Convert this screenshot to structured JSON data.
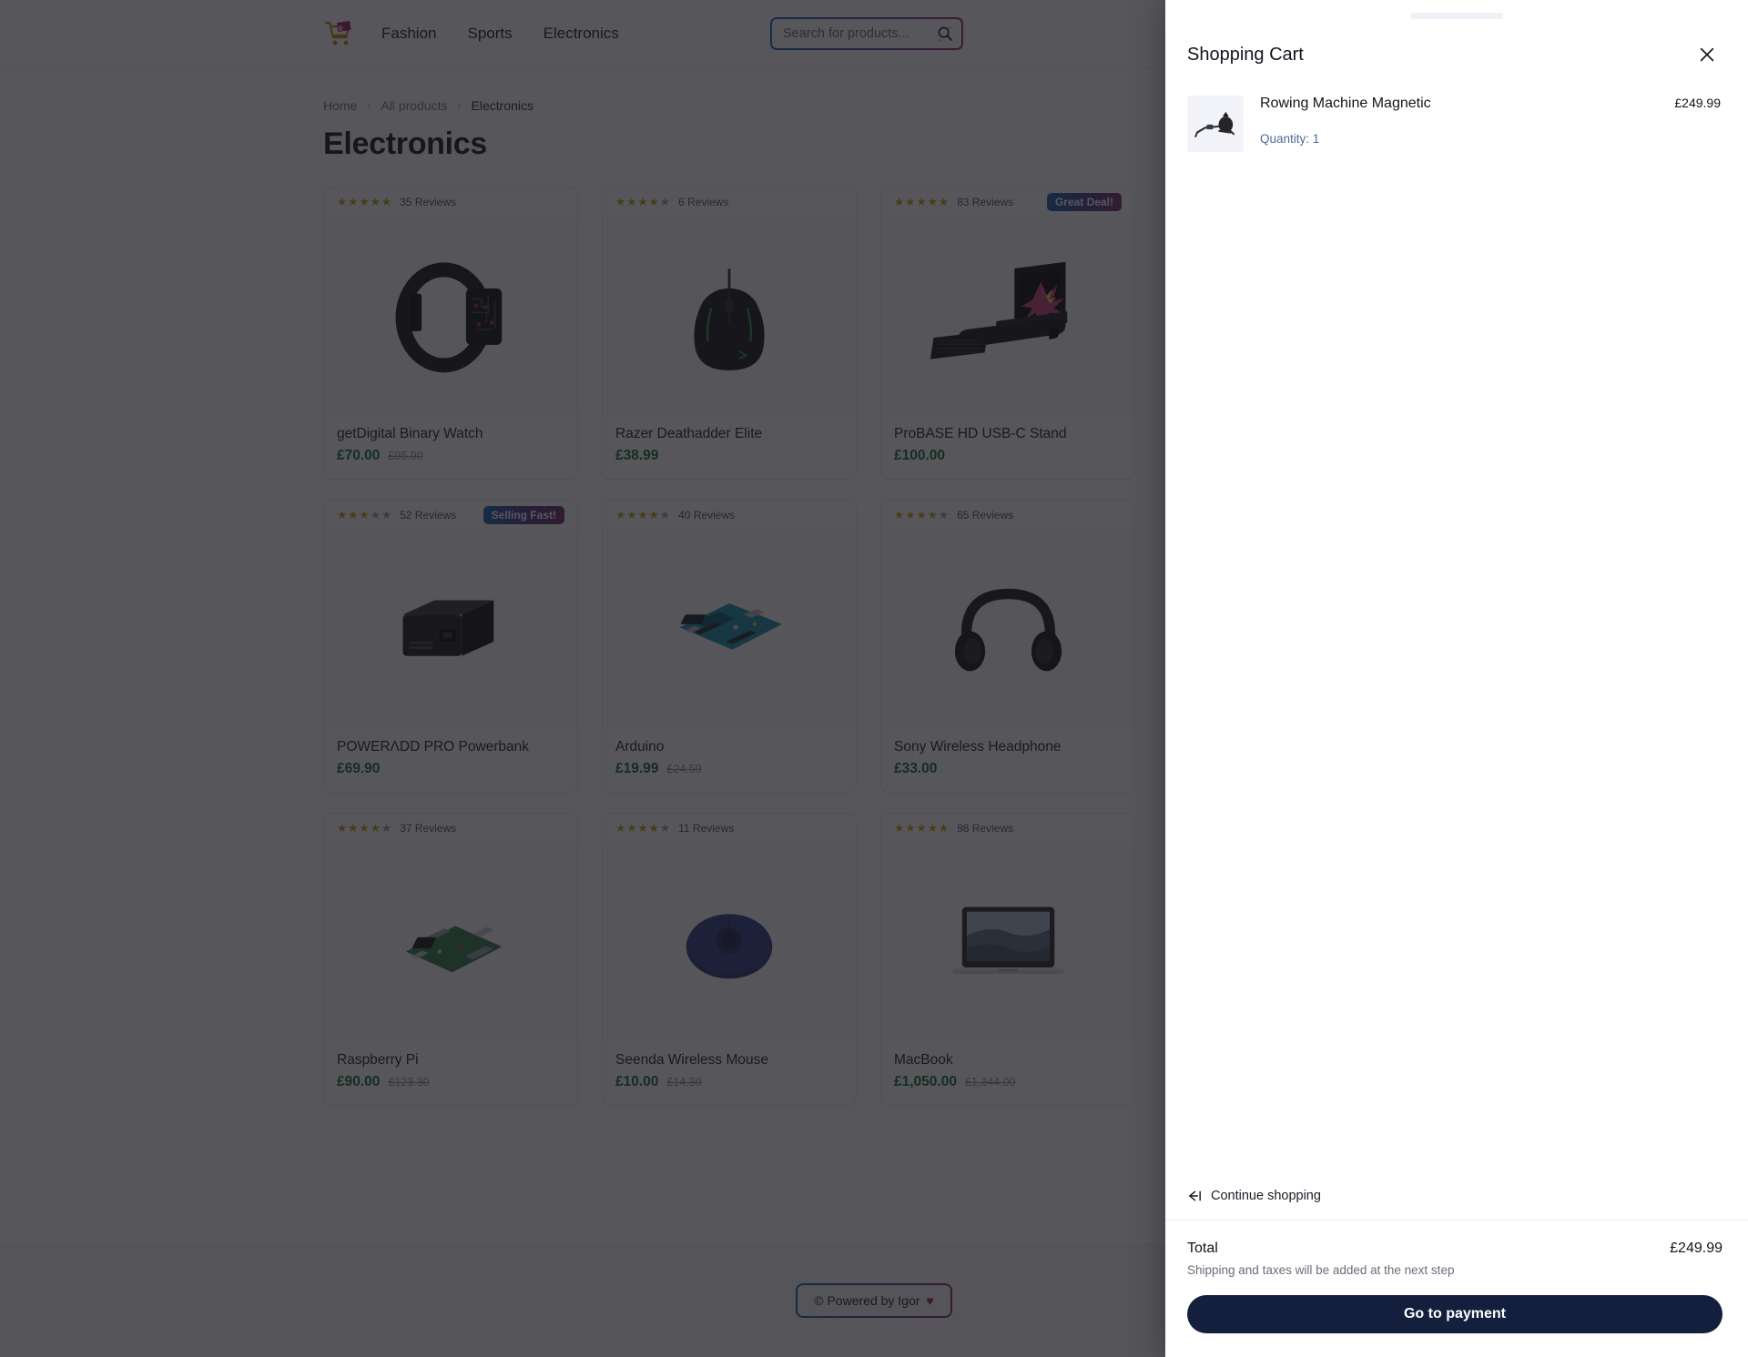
{
  "header": {
    "logo_alt": "shopping-cart-logo",
    "nav": [
      {
        "label": "Fashion"
      },
      {
        "label": "Sports"
      },
      {
        "label": "Electronics"
      }
    ],
    "search": {
      "placeholder": "Search for products...",
      "value": "",
      "icon": "search-icon"
    }
  },
  "breadcrumb": {
    "items": [
      {
        "label": "Home",
        "active": false
      },
      {
        "label": "All products",
        "active": false
      },
      {
        "label": "Electronics",
        "active": true
      }
    ],
    "separator": "›"
  },
  "page": {
    "title": "Electronics"
  },
  "products": [
    {
      "name": "getDigital Binary Watch",
      "price": "£70.00",
      "old_price": "£95.90",
      "reviews": "35 Reviews",
      "stars": 5,
      "badge": null,
      "image": "binary-watch"
    },
    {
      "name": "Razer Deathadder Elite",
      "price": "£38.99",
      "old_price": "",
      "reviews": "6 Reviews",
      "stars": 4,
      "badge": null,
      "image": "gaming-mouse"
    },
    {
      "name": "ProBASE HD USB-C Stand",
      "price": "£100.00",
      "old_price": "",
      "reviews": "83 Reviews",
      "stars": 5,
      "badge": "Great Deal!",
      "image": "laptop-stand"
    },
    {
      "name": "POWERΛDD PRO Powerbank",
      "price": "£69.90",
      "old_price": "",
      "reviews": "52 Reviews",
      "stars": 3,
      "badge": "Selling Fast!",
      "image": "powerbank"
    },
    {
      "name": "Arduino",
      "price": "£19.99",
      "old_price": "£24.59",
      "reviews": "40 Reviews",
      "stars": 4,
      "badge": null,
      "image": "arduino-board"
    },
    {
      "name": "Sony Wireless Headphone",
      "price": "£33.00",
      "old_price": "",
      "reviews": "65 Reviews",
      "stars": 4,
      "badge": null,
      "image": "headphones"
    },
    {
      "name": "Raspberry Pi",
      "price": "£90.00",
      "old_price": "£123.30",
      "reviews": "37 Reviews",
      "stars": 4,
      "badge": null,
      "image": "raspberry-pi"
    },
    {
      "name": "Seenda Wireless Mouse",
      "price": "£10.00",
      "old_price": "£14.30",
      "reviews": "11 Reviews",
      "stars": 4,
      "badge": null,
      "image": "blue-mouse"
    },
    {
      "name": "MacBook",
      "price": "£1,050.00",
      "old_price": "£1,344.00",
      "reviews": "98 Reviews",
      "stars": 5,
      "badge": null,
      "image": "macbook"
    }
  ],
  "footer": {
    "powered_text": "© Powered by Igor",
    "heart": "♥"
  },
  "cart": {
    "title": "Shopping Cart",
    "close_icon": "close-icon",
    "items": [
      {
        "name": "Rowing Machine Magnetic",
        "price": "£249.99",
        "quantity_label": "Quantity: 1",
        "image": "rowing-machine"
      }
    ],
    "continue_label": "Continue shopping",
    "continue_icon": "arrow-left-to-bar-icon",
    "total_label": "Total",
    "total_amount": "£249.99",
    "shipping_note": "Shipping and taxes will be added at the next step",
    "pay_button": "Go to payment"
  },
  "colors": {
    "accent_gradient_start": "#1566b0",
    "accent_gradient_end": "#8b2a6b",
    "price_green": "#0b6b2c",
    "pay_button": "#131f3d",
    "star_gold": "#c8a007",
    "quantity_blue": "#4d6a9a"
  }
}
